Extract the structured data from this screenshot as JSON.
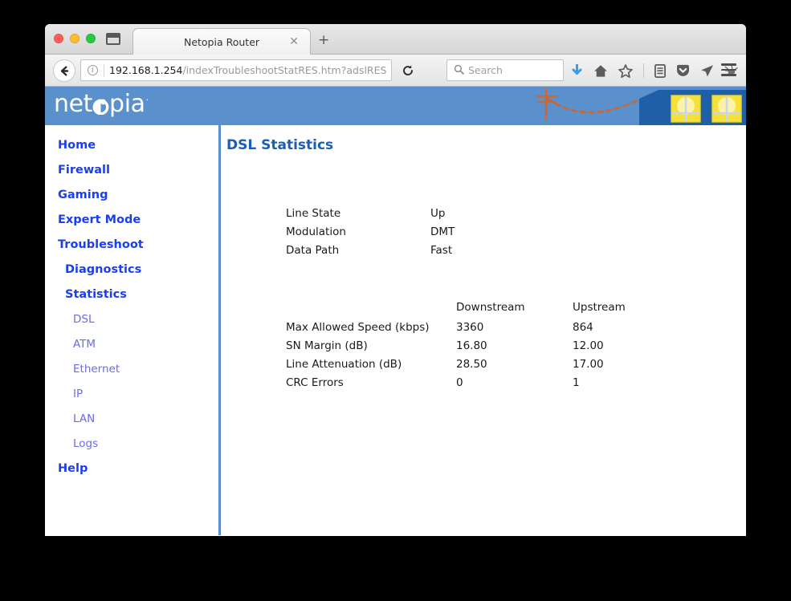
{
  "browser": {
    "tab": {
      "title": "Netopia Router",
      "close_icon": "close-icon",
      "new_tab_icon": "plus-icon"
    },
    "back_icon": "back-arrow-icon",
    "url": {
      "host": "192.168.1.254",
      "path": "/indexTroubleshootStatRES.htm?adslRES",
      "info_icon": "info-icon"
    },
    "reload_icon": "reload-icon",
    "search": {
      "placeholder": "Search",
      "icon": "search-icon"
    },
    "toolbar_icons": [
      "download-icon",
      "home-icon",
      "star-bookmark-icon",
      "library-icon",
      "pocket-icon",
      "send-tab-icon",
      "extension-icon",
      "chevron-down-icon"
    ],
    "menu_icon": "hamburger-menu-icon",
    "window_controls": [
      "close-button",
      "minimize-button",
      "maximize-button"
    ],
    "sidebar_toggle_icon": "sidebar-toggle-icon"
  },
  "banner": {
    "logo_text_before": "net",
    "logo_text_o": "o",
    "logo_text_after": "pia",
    "logo_registered": ".",
    "art": {
      "pole_icon": "utility-pole-icon",
      "line_icon": "dashed-signal-line-icon",
      "house_icon": "house-icon",
      "window_icon": "lit-window-icon"
    },
    "colors": {
      "banner_blue": "#5a90cc",
      "house_blue": "#1f5fa8",
      "window_yellow": "#f5e03c",
      "pole_orange": "#cc6633"
    }
  },
  "sidebar": {
    "items": [
      {
        "label": "Home",
        "level": 1
      },
      {
        "label": "Firewall",
        "level": 1
      },
      {
        "label": "Gaming",
        "level": 1
      },
      {
        "label": "Expert Mode",
        "level": 1
      },
      {
        "label": "Troubleshoot",
        "level": 1
      },
      {
        "label": "Diagnostics",
        "level": 2
      },
      {
        "label": "Statistics",
        "level": 2
      },
      {
        "label": "DSL",
        "level": 3
      },
      {
        "label": "ATM",
        "level": 3
      },
      {
        "label": "Ethernet",
        "level": 3
      },
      {
        "label": "IP",
        "level": 3
      },
      {
        "label": "LAN",
        "level": 3
      },
      {
        "label": "Logs",
        "level": 3
      },
      {
        "label": "Help",
        "level": 1
      }
    ]
  },
  "main": {
    "title": "DSL Statistics",
    "basic_table": {
      "rows": [
        {
          "label": "Line State",
          "value": "Up"
        },
        {
          "label": "Modulation",
          "value": "DMT"
        },
        {
          "label": "Data Path",
          "value": "Fast"
        }
      ]
    },
    "detail_table": {
      "columns": [
        "",
        "Downstream",
        "Upstream"
      ],
      "rows": [
        {
          "label": "Max Allowed Speed (kbps)",
          "downstream": "3360",
          "upstream": "864"
        },
        {
          "label": "SN Margin (dB)",
          "downstream": "16.80",
          "upstream": "12.00"
        },
        {
          "label": "Line Attenuation (dB)",
          "downstream": "28.50",
          "upstream": "17.00"
        },
        {
          "label": "CRC Errors",
          "downstream": "0",
          "upstream": "1"
        }
      ]
    }
  },
  "colors": {
    "link_blue": "#1b3ef0",
    "sublink_blue": "#6b6be8",
    "title_blue": "#1a5fb4"
  }
}
